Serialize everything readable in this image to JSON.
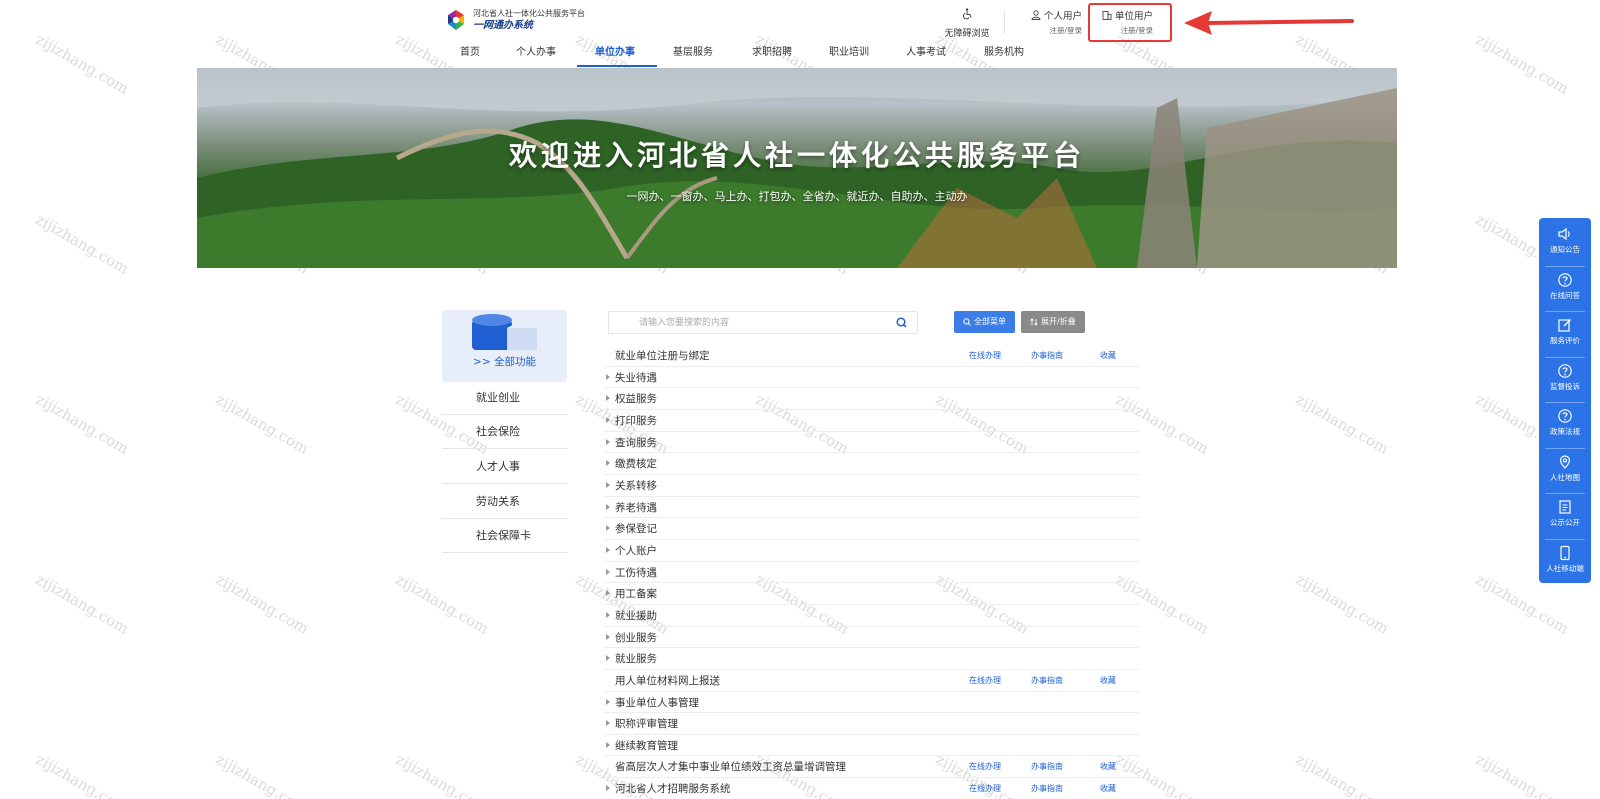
{
  "header": {
    "logo_line1": "河北省人社一体化公共服务平台",
    "logo_line2": "一网通办系统",
    "accessibility_label": "无障碍浏览",
    "personal_user": {
      "title": "个人用户",
      "sub": "注册/登录"
    },
    "unit_user": {
      "title": "单位用户",
      "sub": "注册/登录"
    }
  },
  "nav": {
    "items": [
      "首页",
      "个人办事",
      "单位办事",
      "基层服务",
      "求职招聘",
      "职业培训",
      "人事考试",
      "服务机构"
    ],
    "active": "单位办事"
  },
  "banner": {
    "title": "欢迎进入河北省人社一体化公共服务平台",
    "subtitle": "一网办、一窗办、马上办、打包办、全省办、就近办、自助办、主动办"
  },
  "sidebar": {
    "all_label": ">> 全部功能",
    "items": [
      "就业创业",
      "社会保险",
      "人才人事",
      "劳动关系",
      "社会保障卡"
    ]
  },
  "search": {
    "placeholder": "请输入您要搜索的内容"
  },
  "toolbar": {
    "all_menu": "全部菜单",
    "expand_collapse": "展开/折叠"
  },
  "list": {
    "rows": [
      {
        "label": "就业单位注册与绑定",
        "expandable": false,
        "links": [
          "在线办理",
          "办事指南",
          "收藏"
        ]
      },
      {
        "label": "失业待遇",
        "expandable": true,
        "links": []
      },
      {
        "label": "权益服务",
        "expandable": true,
        "links": []
      },
      {
        "label": "打印服务",
        "expandable": true,
        "links": []
      },
      {
        "label": "查询服务",
        "expandable": true,
        "links": []
      },
      {
        "label": "缴费核定",
        "expandable": true,
        "links": []
      },
      {
        "label": "关系转移",
        "expandable": true,
        "links": []
      },
      {
        "label": "养老待遇",
        "expandable": true,
        "links": []
      },
      {
        "label": "参保登记",
        "expandable": true,
        "links": []
      },
      {
        "label": "个人账户",
        "expandable": true,
        "links": []
      },
      {
        "label": "工伤待遇",
        "expandable": true,
        "links": []
      },
      {
        "label": "用工备案",
        "expandable": true,
        "links": []
      },
      {
        "label": "就业援助",
        "expandable": true,
        "links": []
      },
      {
        "label": "创业服务",
        "expandable": true,
        "links": []
      },
      {
        "label": "就业服务",
        "expandable": true,
        "links": []
      },
      {
        "label": "用人单位材料网上报送",
        "expandable": false,
        "links": [
          "在线办理",
          "办事指南",
          "收藏"
        ]
      },
      {
        "label": "事业单位人事管理",
        "expandable": true,
        "links": []
      },
      {
        "label": "职称评审管理",
        "expandable": true,
        "links": []
      },
      {
        "label": "继续教育管理",
        "expandable": true,
        "links": []
      },
      {
        "label": "省高层次人才集中事业单位绩效工资总量增调管理",
        "expandable": false,
        "links": [
          "在线办理",
          "办事指南",
          "收藏"
        ]
      },
      {
        "label": "河北省人才招聘服务系统",
        "expandable": true,
        "links": [
          "在线办理",
          "办事指南",
          "收藏"
        ]
      }
    ]
  },
  "right_bar": {
    "items": [
      {
        "label": "通知公告",
        "icon": "speaker-icon"
      },
      {
        "label": "在线问答",
        "icon": "question-icon"
      },
      {
        "label": "服务评价",
        "icon": "edit-icon"
      },
      {
        "label": "监督投诉",
        "icon": "question-icon"
      },
      {
        "label": "政策法规",
        "icon": "question-icon"
      },
      {
        "label": "人社地图",
        "icon": "map-pin-icon"
      },
      {
        "label": "公示公开",
        "icon": "document-icon"
      },
      {
        "label": "人社移动端",
        "icon": "mobile-icon"
      }
    ]
  },
  "watermark": "zijizhang.com",
  "colors": {
    "brand_blue": "#1f5fd1",
    "annotation_red": "#e53935",
    "sidebar_blue": "#2b73e6"
  }
}
